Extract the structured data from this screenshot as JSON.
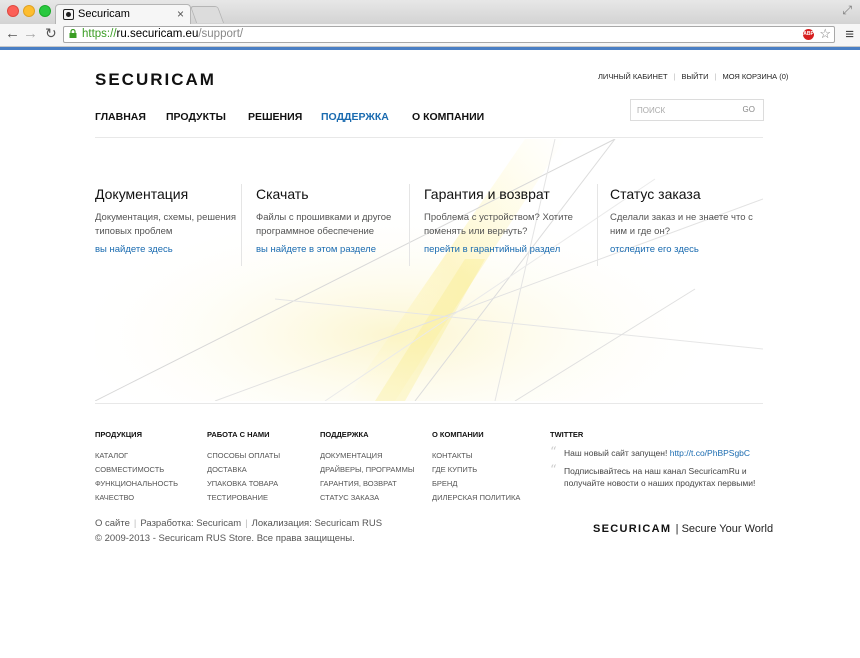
{
  "browser": {
    "tab_title": "Securicam",
    "tab_close": "×",
    "url_scheme": "https://",
    "url_host": "ru.securicam.eu",
    "url_path": "/support/",
    "abp_label": "ABP"
  },
  "header": {
    "logo": "SECURICAM",
    "account_links": [
      "ЛИЧНЫЙ КАБИНЕТ",
      "ВЫЙТИ",
      "МОЯ КОРЗИНА (0)"
    ],
    "nav": [
      "ГЛАВНАЯ",
      "ПРОДУКТЫ",
      "РЕШЕНИЯ",
      "ПОДДЕРЖКА",
      "О КОМПАНИИ"
    ],
    "search_placeholder": "ПОИСК",
    "search_button": "GO",
    "accent_color": "#1a6bb0"
  },
  "support": [
    {
      "title": "Документация",
      "desc": "Документация, схемы, решения типовых проблем",
      "link": "вы найдете здесь"
    },
    {
      "title": "Скачать",
      "desc": "Файлы с прошивками и другое программное обеспечение",
      "link": "вы найдете в этом разделе"
    },
    {
      "title": "Гарантия и возврат",
      "desc": "Проблема с устройством? Хотите поменять или вернуть?",
      "link": "перейти в гарантийный раздел"
    },
    {
      "title": "Статус заказа",
      "desc": "Сделали заказ и не знаете что с ним и где он?",
      "link": "отследите его здесь"
    }
  ],
  "footer": {
    "columns": [
      {
        "title": "ПРОДУКЦИЯ",
        "items": [
          "КАТАЛОГ",
          "СОВМЕСТИМОСТЬ",
          "ФУНКЦИОНАЛЬНОСТЬ",
          "КАЧЕСТВО"
        ]
      },
      {
        "title": "РАБОТА С НАМИ",
        "items": [
          "СПОСОБЫ ОПЛАТЫ",
          "ДОСТАВКА",
          "УПАКОВКА ТОВАРА",
          "ТЕСТИРОВАНИЕ"
        ]
      },
      {
        "title": "ПОДДЕРЖКА",
        "items": [
          "ДОКУМЕНТАЦИЯ",
          "ДРАЙВЕРЫ, ПРОГРАММЫ",
          "ГАРАНТИЯ, ВОЗВРАТ",
          "СТАТУС ЗАКАЗА"
        ]
      },
      {
        "title": "О КОМПАНИИ",
        "items": [
          "КОНТАКТЫ",
          "ГДЕ КУПИТЬ",
          "БРЕНД",
          "ДИЛЕРСКАЯ ПОЛИТИКА"
        ]
      }
    ],
    "twitter": {
      "title": "TWITTER",
      "quote_mark": "“",
      "tweet1_text": "Наш новый сайт запущен!",
      "tweet1_link": "http://t.co/PhBPSgbC",
      "tweet2_text": "Подписывайтесь на наш канал SecuricamRu и получайте новости о наших продуктах первыми!"
    },
    "credits": [
      "О сайте",
      "Разработка: Securicam",
      "Локализация: Securicam RUS"
    ],
    "copyright": "© 2009-2013 - Securicam RUS Store. Все права защищены.",
    "logo": "SECURICAM",
    "slogan": "| Secure Your World"
  }
}
